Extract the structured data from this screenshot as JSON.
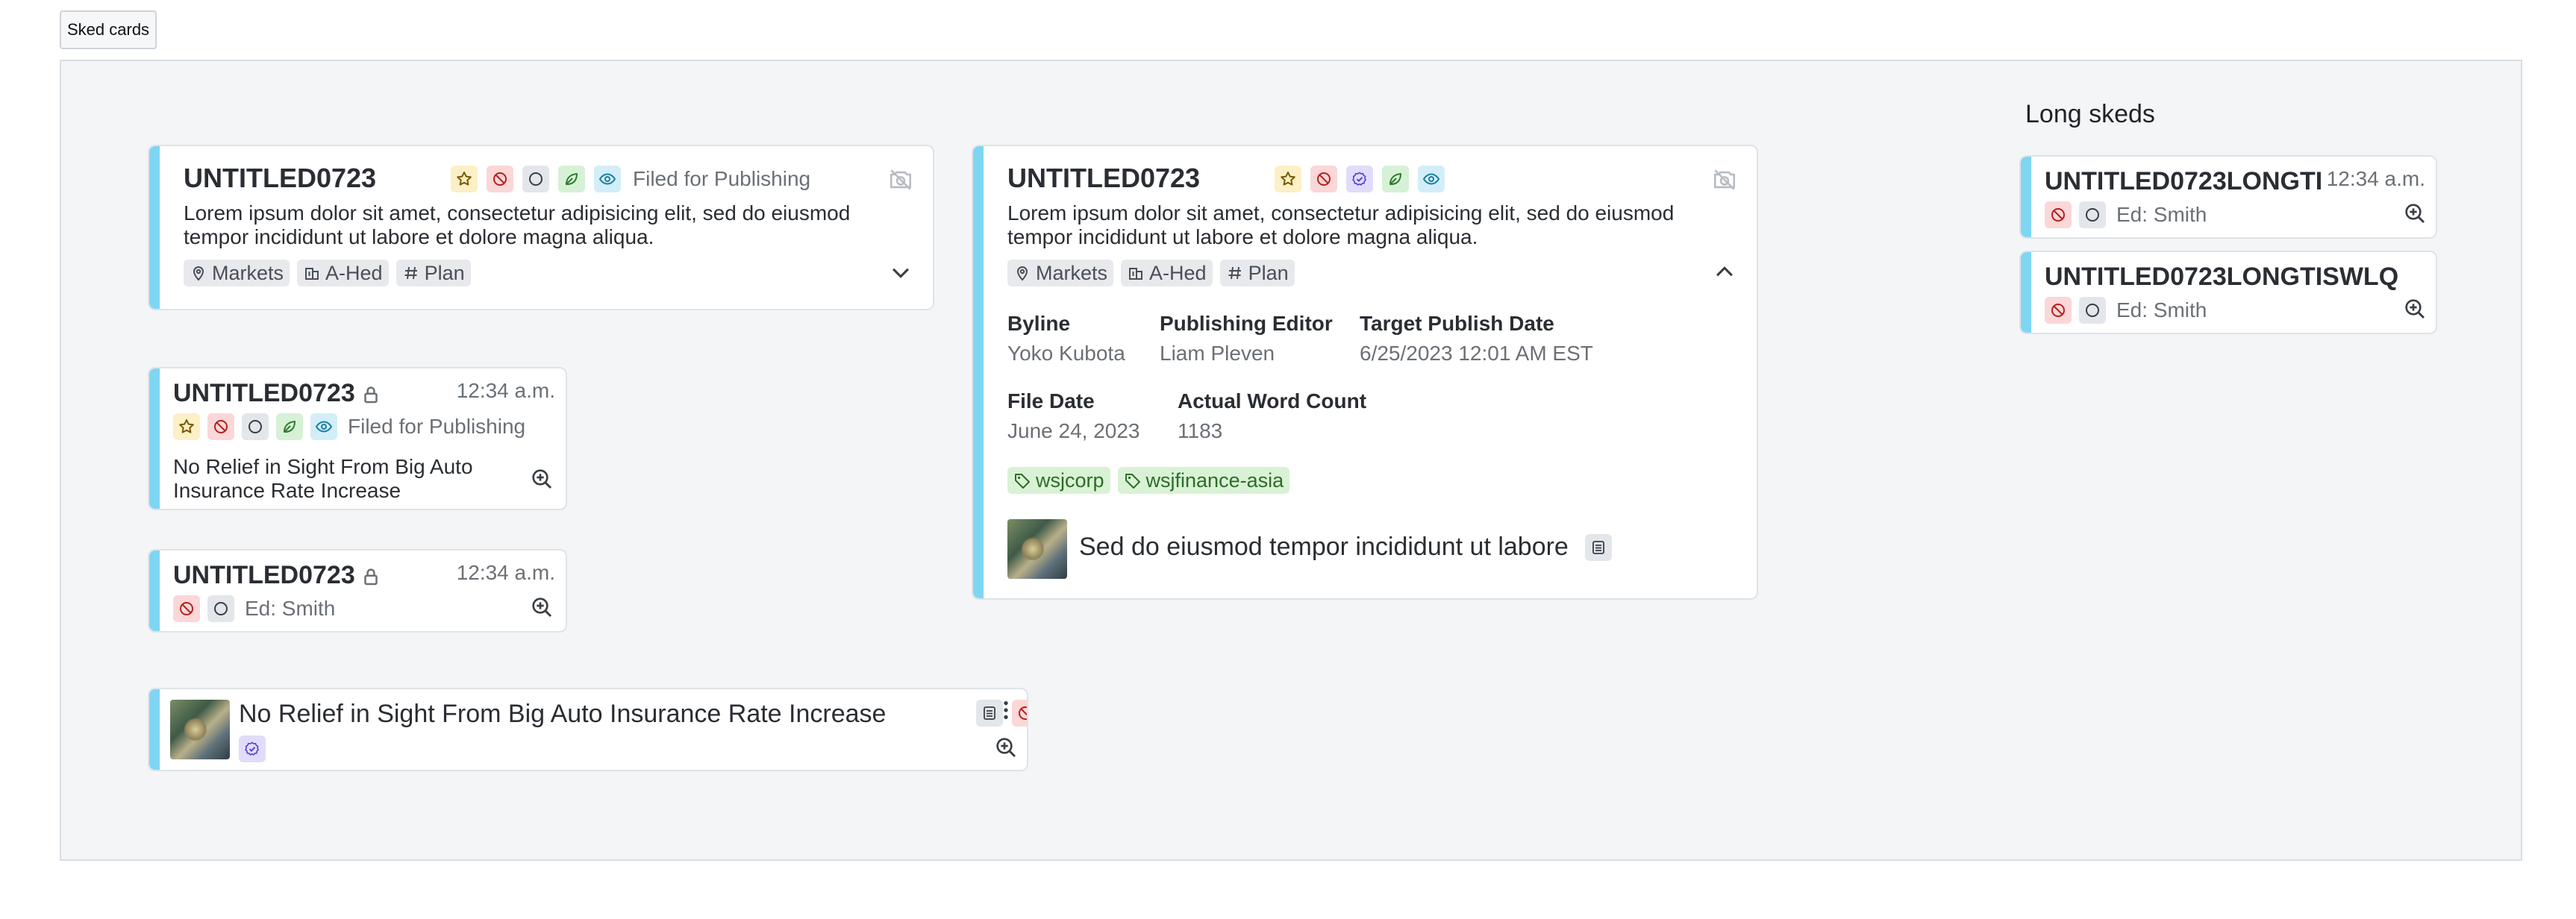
{
  "tab_label": "Sked cards",
  "long_skeds_title": "Long skeds",
  "card1": {
    "slug": "UNTITLED0723",
    "status": "Filed for Publishing",
    "description": "Lorem ipsum dolor sit amet, consectetur adipisicing elit, sed do eiusmod tempor incididunt ut labore et dolore magna aliqua.",
    "tags": [
      "Markets",
      "A-Hed",
      "Plan"
    ]
  },
  "card2": {
    "slug": "UNTITLED0723",
    "time": "12:34 a.m.",
    "status": "Filed for Publishing",
    "headline": "No Relief in Sight From Big Auto Insurance Rate Increase"
  },
  "card3": {
    "slug": "UNTITLED0723",
    "time": "12:34 a.m.",
    "editor": "Ed: Smith"
  },
  "card4": {
    "headline": "No Relief in Sight From Big Auto Insurance Rate Increase"
  },
  "card5": {
    "slug": "UNTITLED0723",
    "description": "Lorem ipsum dolor sit amet, consectetur adipisicing elit, sed do eiusmod tempor incididunt ut labore et dolore magna aliqua.",
    "tags": [
      "Markets",
      "A-Hed",
      "Plan"
    ],
    "fields": {
      "byline_label": "Byline",
      "byline_value": "Yoko Kubota",
      "editor_label": "Publishing Editor",
      "editor_value": "Liam Pleven",
      "target_label": "Target Publish Date",
      "target_value": "6/25/2023 12:01 AM EST",
      "file_label": "File Date",
      "file_value": "June 24, 2023",
      "words_label": "Actual Word Count",
      "words_value": "1183"
    },
    "keywords": [
      "wsjcorp",
      "wsjfinance-asia"
    ],
    "linked_story": "Sed do eiusmod tempor incididunt ut labore"
  },
  "long1": {
    "slug": "UNTITLED0723LONGTI",
    "time": "12:34 a.m.",
    "editor": "Ed: Smith"
  },
  "long2": {
    "slug": "UNTITLED0723LONGTISWLQ",
    "editor": "Ed: Smith"
  },
  "colors": {
    "accent_bar": "#7ed6f2",
    "canvas_bg": "#f4f5f7",
    "tag_green_bg": "#d9f2d5"
  }
}
